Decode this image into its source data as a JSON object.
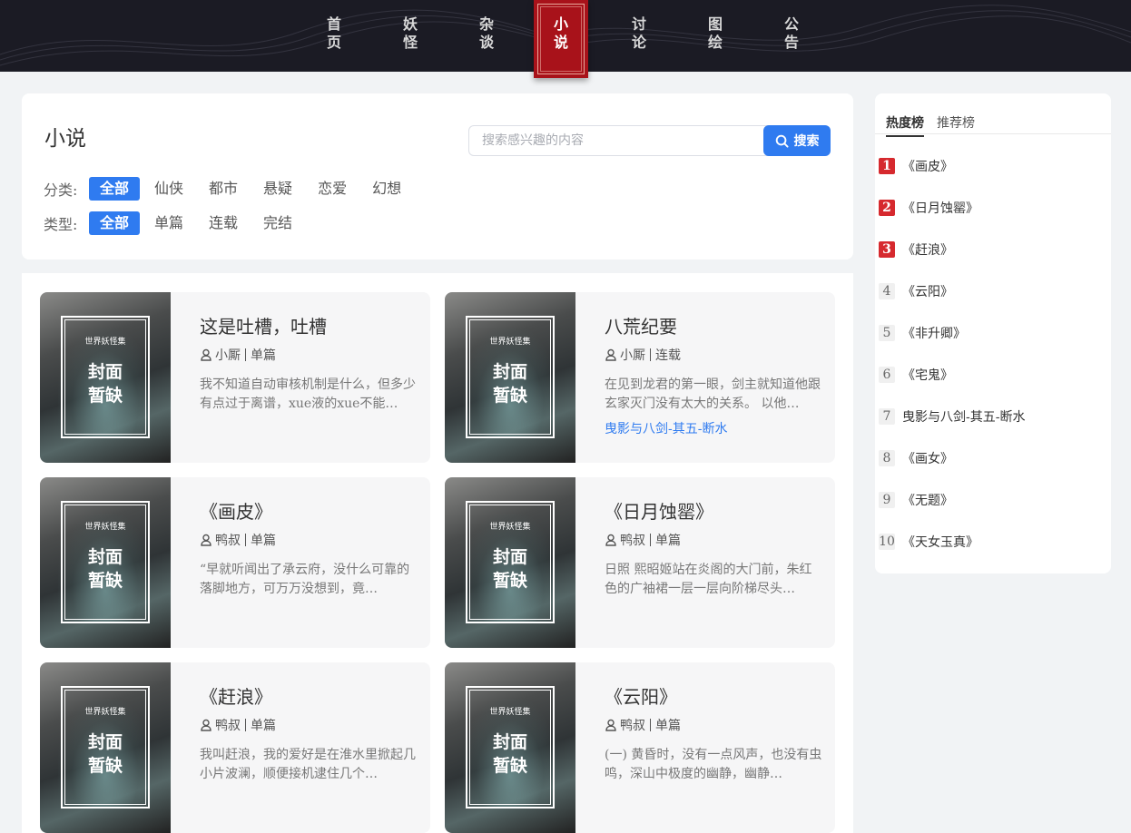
{
  "nav": {
    "items": [
      {
        "line1": "首",
        "line2": "页"
      },
      {
        "line1": "妖",
        "line2": "怪"
      },
      {
        "line1": "杂",
        "line2": "谈"
      },
      {
        "line1": "小",
        "line2": "说"
      },
      {
        "line1": "讨",
        "line2": "论"
      },
      {
        "line1": "图",
        "line2": "绘"
      },
      {
        "line1": "公",
        "line2": "告"
      }
    ],
    "active_index": 3
  },
  "page": {
    "title": "小说"
  },
  "search": {
    "placeholder": "搜索感兴趣的内容",
    "button_label": "搜索",
    "button_icon": "search-icon"
  },
  "filters": {
    "category": {
      "label": "分类:",
      "options": [
        "全部",
        "仙侠",
        "都市",
        "悬疑",
        "恋爱",
        "幻想"
      ],
      "selected": "全部"
    },
    "type": {
      "label": "类型:",
      "options": [
        "全部",
        "单篇",
        "连载",
        "完结"
      ],
      "selected": "全部"
    }
  },
  "cover": {
    "series": "世界妖怪集",
    "line1": "封面",
    "line2": "暂缺"
  },
  "novels": [
    {
      "title": "这是吐槽，吐槽",
      "author": "小厮",
      "kind": "单篇",
      "desc": "我不知道自动审核机制是什么，但多少有点过于离谱，xue液的xue不能…",
      "tag": ""
    },
    {
      "title": "八荒纪要",
      "author": "小厮",
      "kind": "连载",
      "desc": "在见到龙君的第一眼，剑主就知道他跟玄家灭门没有太大的关系。 以他…",
      "tag": "曳影与八剑-其五-断水"
    },
    {
      "title": "《画皮》",
      "author": "鸭叔",
      "kind": "单篇",
      "desc": "“早就听闻出了承云府，没什么可靠的落脚地方，可万万没想到，竟…",
      "tag": ""
    },
    {
      "title": "《日月蚀罂》",
      "author": "鸭叔",
      "kind": "单篇",
      "desc": "日照 熙昭姬站在炎阁的大门前，朱红色的广袖裙一层一层向阶梯尽头…",
      "tag": ""
    },
    {
      "title": "《赶浪》",
      "author": "鸭叔",
      "kind": "单篇",
      "desc": "我叫赶浪，我的爱好是在淮水里掀起几小片波澜，顺便接机逮住几个…",
      "tag": ""
    },
    {
      "title": "《云阳》",
      "author": "鸭叔",
      "kind": "单篇",
      "desc": "(一) 黄昏时，没有一点风声，也没有虫鸣，深山中极度的幽静，幽静…",
      "tag": ""
    }
  ],
  "ranking": {
    "tabs": [
      "热度榜",
      "推荐榜"
    ],
    "active_tab": "热度榜",
    "items": [
      {
        "rank": "1",
        "title": "《画皮》"
      },
      {
        "rank": "2",
        "title": "《日月蚀罂》"
      },
      {
        "rank": "3",
        "title": "《赶浪》"
      },
      {
        "rank": "4",
        "title": "《云阳》"
      },
      {
        "rank": "5",
        "title": "《非升卿》"
      },
      {
        "rank": "6",
        "title": "《宅鬼》"
      },
      {
        "rank": "7",
        "title": "曳影与八剑-其五-断水"
      },
      {
        "rank": "8",
        "title": "《画女》"
      },
      {
        "rank": "9",
        "title": "《无题》"
      },
      {
        "rank": "10",
        "title": "《天女玉真》"
      }
    ]
  },
  "colors": {
    "accent": "#2f7bf0",
    "nav_active": "#a8121a",
    "rank_top": "#d6292e",
    "header_bg": "#1b1b24"
  }
}
